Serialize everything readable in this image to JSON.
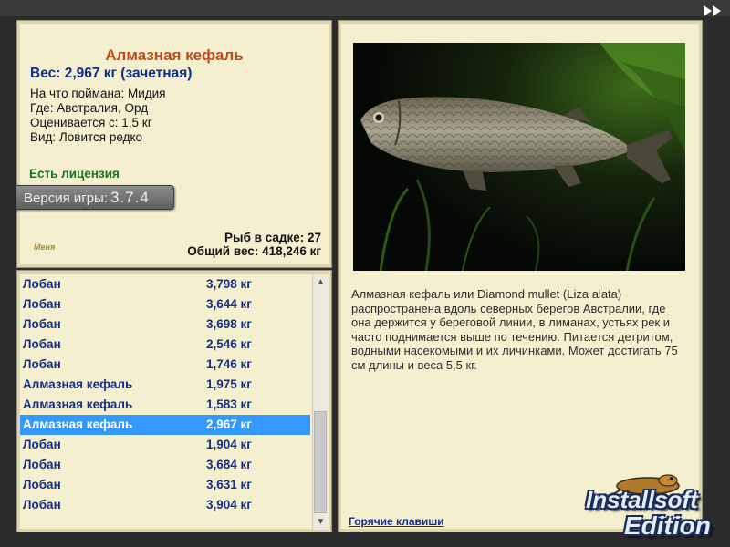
{
  "fish": {
    "title": "Алмазная кефаль",
    "weight_line": "Вес: 2,967 кг (зачетная)",
    "caught_on": "На что поймана: Мидия",
    "location": "Где: Австралия, Орд",
    "valued_from": "Оценивается с: 1,5 кг",
    "rarity": "Вид: Ловится редко",
    "license": "Есть лицензия"
  },
  "version": {
    "label": "Версия игры:",
    "number": "3.7.4"
  },
  "logo_text": "Меня",
  "summary": {
    "fish_count": "Рыб в садке: 27",
    "total_weight": "Общий вес: 418,246 кг"
  },
  "catch_list": [
    {
      "name": "Лобан",
      "weight": "3,798 кг"
    },
    {
      "name": "Лобан",
      "weight": "3,644 кг"
    },
    {
      "name": "Лобан",
      "weight": "3,698 кг"
    },
    {
      "name": "Лобан",
      "weight": "2,546 кг"
    },
    {
      "name": "Лобан",
      "weight": "1,746 кг"
    },
    {
      "name": "Алмазная кефаль",
      "weight": "1,975 кг"
    },
    {
      "name": "Алмазная кефаль",
      "weight": "1,583 кг"
    },
    {
      "name": "Алмазная кефаль",
      "weight": "2,967 кг",
      "selected": true
    },
    {
      "name": "Лобан",
      "weight": "1,904 кг"
    },
    {
      "name": "Лобан",
      "weight": "3,684 кг"
    },
    {
      "name": "Лобан",
      "weight": "3,631 кг"
    },
    {
      "name": "Лобан",
      "weight": "3,904 кг"
    }
  ],
  "description": "Алмазная кефаль или Diamond mullet (Liza alata) распространена вдоль северных берегов Австралии, где она держится у береговой линии, в лиманах, устьях рек и часто поднимается выше по течению. Питается детритом, водными насекомыми и их личинками. Может достигать 75 см длины и веса 5,5 кг.",
  "hotkeys_link": "Горячие клавиши",
  "watermark": {
    "line1": "Installsoft",
    "line2": "Edition"
  },
  "icons": {
    "forward": "fast-forward-icon",
    "scroll_up": "chevron-up-icon",
    "scroll_down": "chevron-down-icon"
  },
  "colors": {
    "panel_bg": "#f4efcf",
    "title": "#c04a18",
    "weight": "#142e88",
    "license": "#1c7020",
    "selection": "#3399ff"
  }
}
